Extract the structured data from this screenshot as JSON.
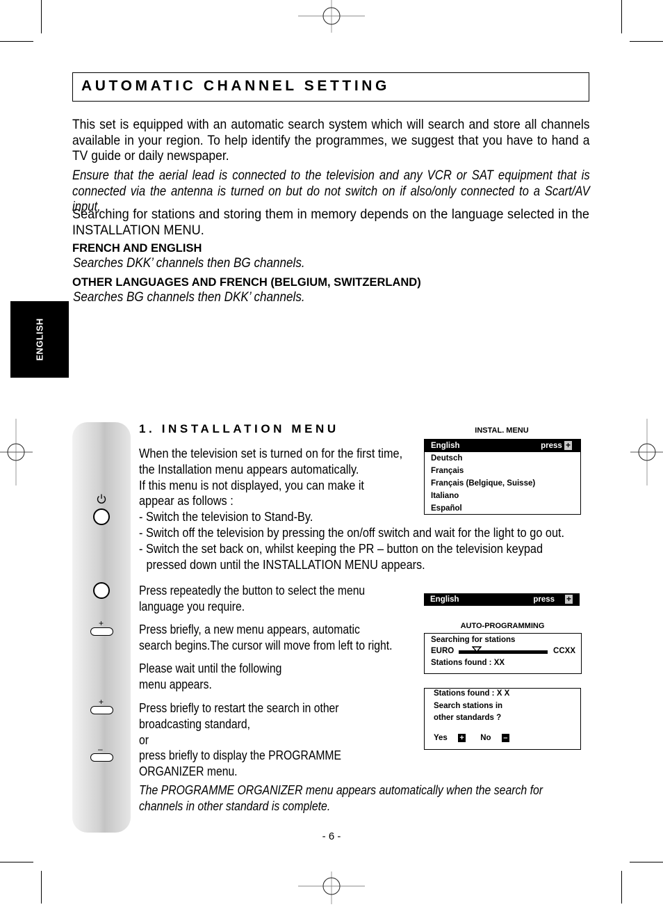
{
  "header": {
    "title": "AUTOMATIC CHANNEL SETTING"
  },
  "side_tab": {
    "label": "ENGLISH"
  },
  "intro": {
    "p1": "This set is equipped with an automatic search system which will search and store all channels available in your region. To help identify the programmes, we suggest that you have to hand a TV guide or daily newspaper.",
    "p2": "Ensure that the aerial lead is connected to the television and any VCR or SAT equipment that is connected via the antenna is turned on but do not switch on if also/only connected to a Scart/AV input.",
    "p3": "Searching for stations and storing them in memory depends on the language selected in the INSTALLATION MENU.",
    "groups": [
      {
        "heading": "FRENCH AND ENGLISH",
        "text": "Searches DKK’ channels then BG channels."
      },
      {
        "heading": "OTHER LANGUAGES AND FRENCH (BELGIUM, SWITZERLAND)",
        "text": "Searches BG channels then DKK’ channels."
      }
    ]
  },
  "section1": {
    "title": "1. INSTALLATION MENU",
    "intro_lines": [
      "When the television set is turned on for the first time,",
      "the Installation menu appears automatically.",
      "If this menu is not displayed, you can make it",
      "appear as follows :",
      "- Switch the television to Stand-By.",
      "- Switch off the television by pressing the on/off switch and wait for the light to go out.",
      "- Switch the set back on, whilst keeping the PR – button on the television keypad",
      "  pressed down until the INSTALLATION MENU appears."
    ],
    "step_select": [
      "Press repeatedly the button to select the menu",
      "language you require."
    ],
    "step_press": [
      "Press briefly, a new menu appears, automatic",
      "search begins.The cursor will move from left to right."
    ],
    "step_wait": [
      "Please wait until the following",
      "menu appears."
    ],
    "step_restart": [
      "Press briefly to restart the search in other",
      "broadcasting standard,",
      "or",
      "press briefly to display the PROGRAMME",
      "ORGANIZER menu."
    ],
    "footer_note": [
      "The PROGRAMME ORGANIZER menu appears automatically when the search for",
      "channels in other standard is complete."
    ]
  },
  "keypad": {
    "buttons": [
      {
        "name": "power-button",
        "symbol": "⏻"
      },
      {
        "name": "menu-button",
        "symbol": ""
      },
      {
        "name": "vol-plus-button",
        "symbol": "+"
      },
      {
        "name": "pr-plus-button",
        "symbol": "+"
      },
      {
        "name": "pr-minus-button",
        "symbol": "–"
      }
    ]
  },
  "osd": {
    "instal_menu": {
      "caption": "INSTAL.   MENU",
      "selected": "English",
      "press_label": "press",
      "press_key": "+",
      "items": [
        "Deutsch",
        "Français",
        "Français (Belgique, Suisse)",
        "Italiano",
        "Español"
      ]
    },
    "language_bar": {
      "label": "English",
      "press_label": "press",
      "press_key": "+"
    },
    "auto_programming": {
      "caption": "AUTO-PROGRAMMING",
      "line1": "Searching for stations",
      "range_start": "EURO",
      "range_end": "CCXX",
      "cursor_progress": 0.2,
      "line3": "Stations found : XX"
    },
    "other_standards": {
      "line1": "Stations found : X X",
      "line2": "Search stations in",
      "line3": "other standards ?",
      "yes_label": "Yes",
      "yes_key": "+",
      "no_label": "No",
      "no_key": "–"
    }
  },
  "page": {
    "number": "- 6 -"
  }
}
